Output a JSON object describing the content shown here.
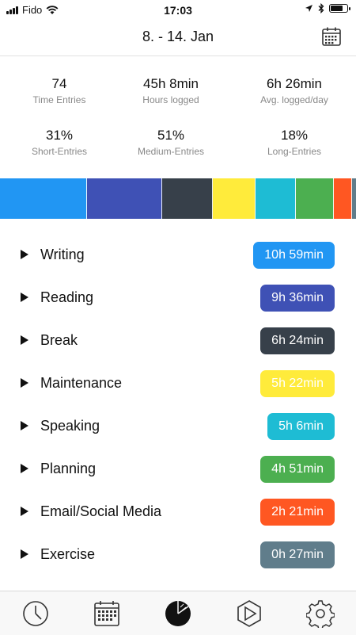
{
  "status_bar": {
    "carrier": "Fido",
    "time": "17:03"
  },
  "header": {
    "title": "8. - 14. Jan",
    "calendar_icon": "calendar-icon"
  },
  "stats": [
    {
      "value": "74",
      "label": "Time Entries"
    },
    {
      "value": "45h 8min",
      "label": "Hours logged"
    },
    {
      "value": "6h 26min",
      "label": "Avg. logged/day"
    },
    {
      "value": "31%",
      "label": "Short-Entries"
    },
    {
      "value": "51%",
      "label": "Medium-Entries"
    },
    {
      "value": "18%",
      "label": "Long-Entries"
    }
  ],
  "categories": [
    {
      "name": "Writing",
      "duration": "10h 59min",
      "minutes": 659,
      "color": "#2196f3"
    },
    {
      "name": "Reading",
      "duration": "9h 36min",
      "minutes": 576,
      "color": "#3f51b5"
    },
    {
      "name": "Break",
      "duration": "6h 24min",
      "minutes": 384,
      "color": "#37404a"
    },
    {
      "name": "Maintenance",
      "duration": "5h 22min",
      "minutes": 322,
      "color": "#ffeb3b"
    },
    {
      "name": "Speaking",
      "duration": "5h 6min",
      "minutes": 306,
      "color": "#1ebcd4"
    },
    {
      "name": "Planning",
      "duration": "4h 51min",
      "minutes": 291,
      "color": "#4caf50"
    },
    {
      "name": "Email/Social Media",
      "duration": "2h 21min",
      "minutes": 141,
      "color": "#ff5722"
    },
    {
      "name": "Exercise",
      "duration": "0h 27min",
      "minutes": 27,
      "color": "#607d8b"
    }
  ],
  "tabs": [
    {
      "icon": "clock-icon",
      "active": false
    },
    {
      "icon": "calendar-grid-icon",
      "active": false
    },
    {
      "icon": "pie-chart-icon",
      "active": true
    },
    {
      "icon": "play-hexagon-icon",
      "active": false
    },
    {
      "icon": "settings-gear-icon",
      "active": false
    }
  ]
}
